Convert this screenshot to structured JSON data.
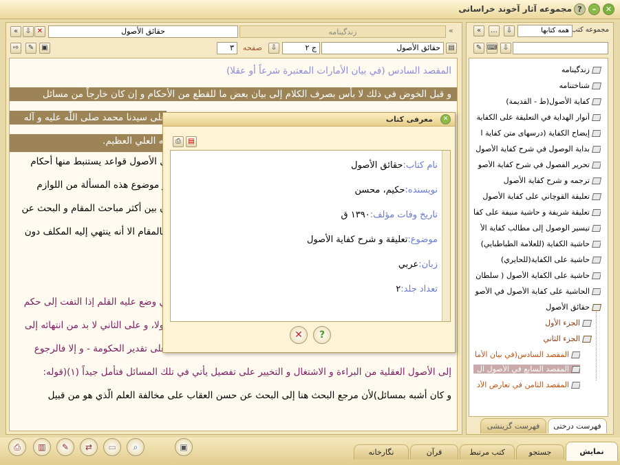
{
  "window": {
    "title": "مجموعه آثار آخوند خراسانی",
    "help": "?"
  },
  "viewer": {
    "tab_label": "زندگینامه",
    "title_field": "حقائق الأصول",
    "book_field": "حقائق الأصول",
    "volume_field": "ج ۲",
    "page_label": "صفحه",
    "page_value": "۳",
    "lines": [
      "المقصد السادس (في بيان الأمارات المعتبرة شرعاً أو عقلا)",
      "و قبل الخوض في ذلك لا بأس بصرف الكلام إلى بيان بعض ما للقطع من الأحكام و إن كان خارجاً من مسائل",
      "على سيدنا محمد صلى اللّٰه عليه و آله",
      "له العلي العظيم.",
      "ل الأصول قواعد يستنبط منها أحكام",
      "و موضوع هذه المسألة من اللوازم",
      "ن بين أكثر مباحث المقام و البحث عن",
      "كالمقام الا أنه ينتهي إليه المكلف دون",
      "ي وضع عليه القلم إذا التفت إلى حكم",
      "أولا، و على الثاني لا بد من انتهائه إلى",
      "على تقدير الحكومة - و إلا فالرجوع",
      "إلى الأصول العقلية من البراءة و الاشتغال و التخيير على تفصيل يأتي في تلك المسائل فتأمل جيداً (١)(قوله:",
      "و كان أشبه بمسائل)لأن مرجع البحث هنا إلى البحث عن حسن العقاب على مخالفة العلم الّذي هو من قبيل"
    ]
  },
  "dialog": {
    "title": "معرفی کتاب",
    "fields": [
      {
        "label": "نام کتاب:",
        "value": "حقائق الأصول"
      },
      {
        "label": "نویسنده:",
        "value": "حکیم، محسن"
      },
      {
        "label": "تاریخ وفات مؤلف:",
        "value": "۱۳۹۰ ق"
      },
      {
        "label": "موضوع:",
        "value": "تعلیقة و شرح كفاية الأصول"
      },
      {
        "label": "زبان:",
        "value": "عربي"
      },
      {
        "label": "تعداد جلد:",
        "value": "۲"
      }
    ]
  },
  "library": {
    "panel_title": "مجموعه کتب",
    "selector": "همه کتابها",
    "items": [
      "زندگینامه",
      "شناختنامه",
      "كفاية الأصول(ط - القديمة)",
      "أنوار الهداية في التعليقة على الكفاية",
      "إيضاح الكفاية (درسهاى متن كفاية ا",
      "بداية الوصول في شرح كفاية الأصول",
      "تحرير الفصول في شرح كفاية الأصو",
      "ترجمه و شرح كفاية الأصول",
      "تعليقة القوچاني على كفاية الأصول",
      "تعليقة شريفة و حاشية منيفة على كفا",
      "تيسير الوصول إلى مطالب كفاية الأ",
      "حاشية الكفاية (للعلامة الطباطبايي)",
      "حاشية على الكفاية(للحايري)",
      "حاشية على الكفاية الأصول ( سلطان",
      "الحاشية على كفاية الأصول في الأصو",
      "حقائق الأصول"
    ],
    "subitems": [
      "الجزء الأول",
      "الجزء الثاني"
    ],
    "leaf_items": [
      "المقصد السادس(في بيان الأما",
      "المقصد السابع في الأصول ال",
      "المقصد الثامن في تعارض الأد"
    ],
    "tab_tree": "فهرست درختی",
    "tab_selected": "فهرست گزینشی"
  },
  "bottom_tabs": [
    "نمایش",
    "جستجو",
    "کتب مرتبط",
    "قرآن",
    "نگارخانه"
  ]
}
